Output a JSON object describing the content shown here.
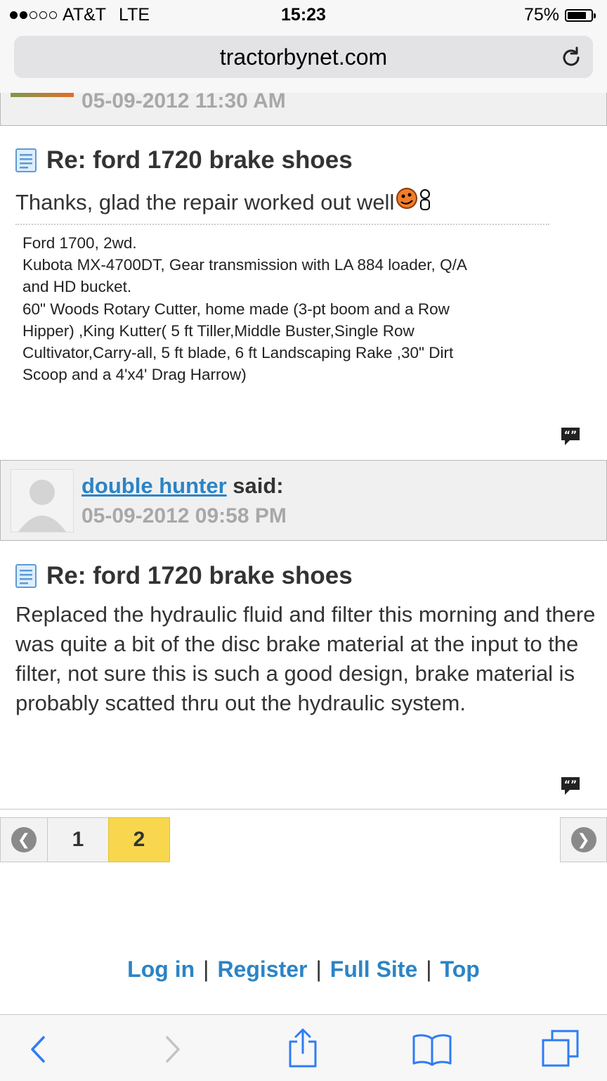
{
  "status_bar": {
    "carrier": "AT&T",
    "network": "LTE",
    "time": "15:23",
    "battery": "75%",
    "battery_level": 0.75,
    "signal_bars": 2
  },
  "browser": {
    "url": "tractorbynet.com"
  },
  "posts": [
    {
      "date": "05-09-2012 11:30 AM",
      "title": "Re: ford 1720 brake shoes",
      "body": "Thanks, glad the repair worked out well",
      "signature": [
        "Ford 1700, 2wd.",
        "Kubota MX-4700DT, Gear transmission with LA 884 loader, Q/A",
        "and HD bucket.",
        "60\" Woods Rotary Cutter, home made (3-pt boom and a Row",
        "Hipper) ,King Kutter( 5 ft Tiller,Middle Buster,Single Row",
        "Cultivator,Carry-all, 5 ft blade, 6 ft Landscaping Rake ,30\" Dirt",
        "Scoop and a 4'x4' Drag Harrow)"
      ]
    },
    {
      "author": "double hunter",
      "said": "said:",
      "date": "05-09-2012 09:58 PM",
      "title": "Re: ford 1720 brake shoes",
      "body": "Replaced the hydraulic fluid and filter this morning and there was quite a bit of the disc brake material at the input to the filter, not sure this is such a good design, brake material is probably scatted thru out the hydraulic system."
    }
  ],
  "pagination": {
    "pages": [
      "1",
      "2"
    ],
    "current": "2"
  },
  "footer": {
    "links": [
      "Log in",
      "Register",
      "Full Site",
      "Top"
    ]
  },
  "colors": {
    "link": "#2b84c6",
    "active_page": "#f8d74e",
    "ios_blue": "#2e7cf6"
  },
  "icons": [
    "reload-icon",
    "document-icon",
    "emoticon-icon",
    "quote-icon",
    "prev-icon",
    "next-icon",
    "back-icon",
    "forward-icon",
    "share-icon",
    "bookmarks-icon",
    "tabs-icon"
  ]
}
